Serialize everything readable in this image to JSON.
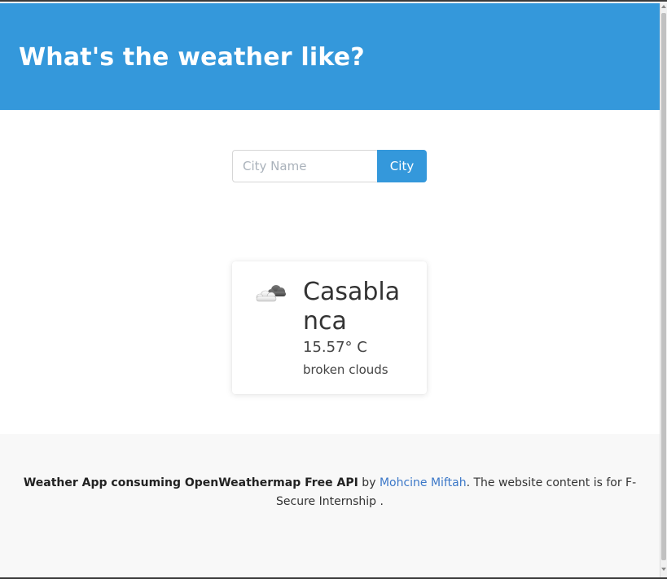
{
  "header": {
    "title": "What's the weather like?"
  },
  "search": {
    "placeholder": "City Name",
    "value": "",
    "button_label": "City"
  },
  "weather": {
    "icon": "broken-clouds-icon",
    "city": "Casablanca",
    "temperature": "15.57° C",
    "description": "broken clouds"
  },
  "footer": {
    "app_name": "Weather App consuming OpenWeathermap Free API",
    "by": " by ",
    "author": "Mohcine Miftah",
    "suffix": ". The website content is for F-Secure Internship ."
  },
  "colors": {
    "brand": "#3498db",
    "link": "#3c78c8",
    "footer_bg": "#f8f8f8"
  }
}
